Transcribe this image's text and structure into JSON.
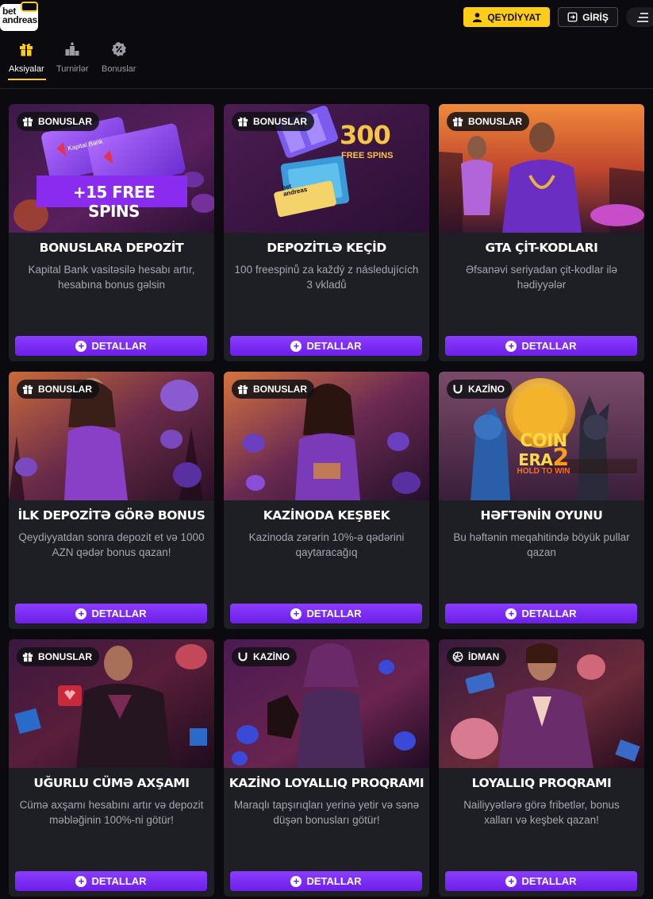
{
  "header": {
    "logo_text_1": "bet",
    "logo_text_2": "andreas",
    "register_label": "QEYDİYYAT",
    "login_label": "GİRİŞ"
  },
  "tabs": [
    {
      "label": "Aksiyalar",
      "icon": "gift-icon",
      "active": true
    },
    {
      "label": "Turnirlər",
      "icon": "podium-icon",
      "active": false
    },
    {
      "label": "Bonuslar",
      "icon": "percent-badge-icon",
      "active": false
    }
  ],
  "cards": [
    {
      "badge": "BONUSLAR",
      "badge_icon": "gift-icon",
      "title": "BONUSLARA DEPOZİT",
      "desc": "Kapital Bank vasitəsilə hesabı artır, hesabına bonus gəlsin",
      "button": "DETALLAR",
      "banner_text": "+15 FREE SPINS",
      "card_brand": "Kapital Bank"
    },
    {
      "badge": "BONUSLAR",
      "badge_icon": "gift-icon",
      "title": "DEPOZİTLƏ KEÇİD",
      "desc": "100 freespinů za každý z následujících 3 vkladů",
      "button": "DETALLAR",
      "banner_number": "300",
      "banner_text": "FREE SPINS",
      "ticket_text_1": "bet",
      "ticket_text_2": "andreas"
    },
    {
      "badge": "BONUSLAR",
      "badge_icon": "gift-icon",
      "title": "GTA ÇİT-KODLARI",
      "desc": "Əfsanəvi seriyadan çit-kodlar ilə hədiyyələr",
      "button": "DETALLAR"
    },
    {
      "badge": "BONUSLAR",
      "badge_icon": "gift-icon",
      "title": "İLK DEPOZİTƏ GÖRƏ BONUS",
      "desc": "Qeydiyyatdan sonra depozit et və 1000 AZN qədər bonus qazan!",
      "button": "DETALLAR"
    },
    {
      "badge": "BONUSLAR",
      "badge_icon": "gift-icon",
      "title": "KAZİNODA KEŞBEK",
      "desc": "Kazinoda zərərin 10%-ə qədərini qaytaracağıq",
      "button": "DETALLAR"
    },
    {
      "badge": "KAZİNO",
      "badge_icon": "horseshoe-icon",
      "title": "HƏFTƏNİN OYUNU",
      "desc": "Bu həftənin meqahitində böyük pullar qazan",
      "button": "DETALLAR",
      "game_logo_1": "COIN",
      "game_logo_2": "ERA",
      "game_logo_3": "2",
      "game_logo_4": "HOLD TO WIN"
    },
    {
      "badge": "BONUSLAR",
      "badge_icon": "gift-icon",
      "title": "UĞURLU CÜMƏ AXŞAMI",
      "desc": "Cümə axşamı hesabını artır və depozit məbləğinin 100%-ni götür!",
      "button": "DETALLAR"
    },
    {
      "badge": "KAZİNO",
      "badge_icon": "horseshoe-icon",
      "title": "KAZİNO LOYALLIQ PROQRAMI",
      "desc": "Maraqlı tapşırıqları yerinə yetir və sənə düşən bonusları götür!",
      "button": "DETALLAR"
    },
    {
      "badge": "İDMAN",
      "badge_icon": "ball-icon",
      "title": "LOYALLIQ PROQRAMI",
      "desc": "Nailiyyətlərə görə fribetlər, bonus xalları və keşbek qazan!",
      "button": "DETALLAR"
    }
  ],
  "colors": {
    "accent_yellow": "#ffcc18",
    "button_purple": "#7b2df5",
    "card_bg": "#1e1e25",
    "page_bg": "#0b0b0f"
  }
}
